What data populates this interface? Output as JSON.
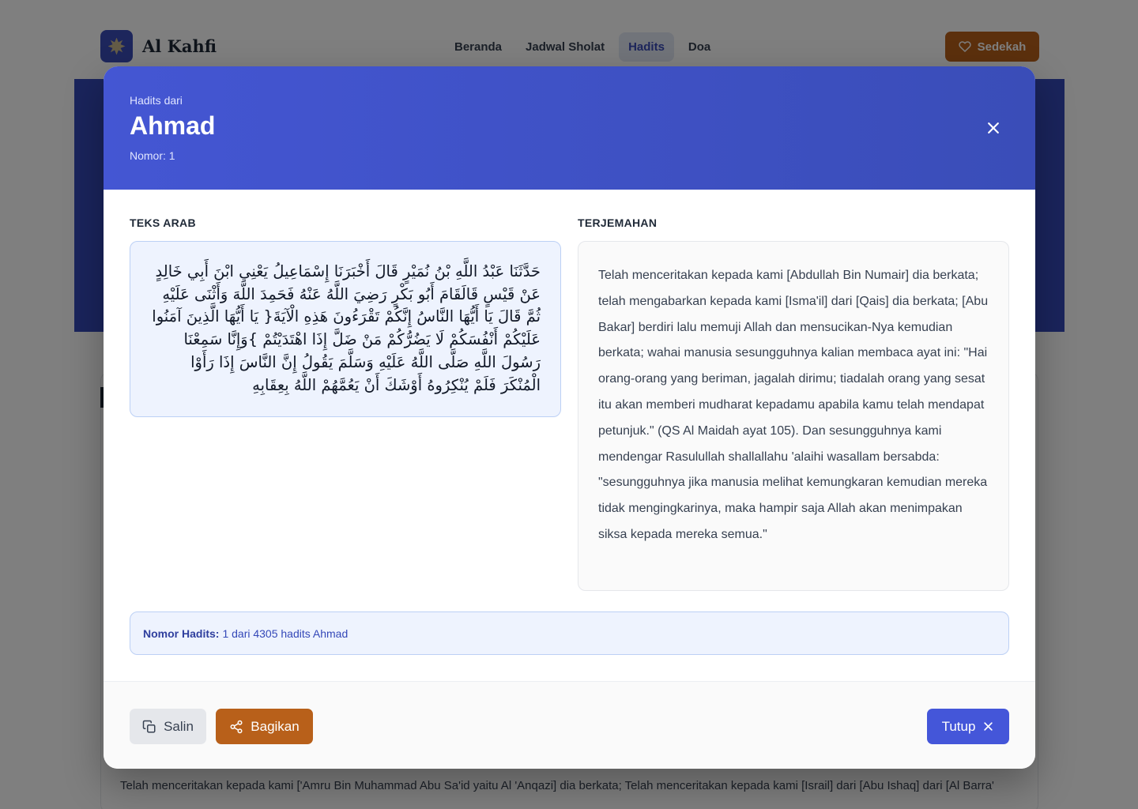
{
  "nav": {
    "brand": "Al Kahfi",
    "links": [
      {
        "label": "Beranda"
      },
      {
        "label": "Jadwal Sholat"
      },
      {
        "label": "Hadits"
      },
      {
        "label": "Doa"
      }
    ],
    "donate_label": "Sedekah"
  },
  "background": {
    "preview_text": "Telah menceritakan kepada kami ['Amru Bin Muhammad Abu Sa'id yaitu Al 'Anqazi] dia berkata; Telah menceritakan kepada kami [Israil] dari [Abu Ishaq] dari [Al Barra'"
  },
  "modal": {
    "kicker": "Hadits dari",
    "title": "Ahmad",
    "nomor": "Nomor: 1",
    "arab_label": "TEKS ARAB",
    "arab_text": "حَدَّثَنَا عَبْدُ اللَّهِ بْنُ نُمَيْرٍ قَالَ أَخْبَرَنَا إِسْمَاعِيلُ يَعْنِي ابْنَ أَبِي خَالِدٍ عَنْ قَيْسٍ قَالَقَامَ أَبُو بَكْرٍ رَضِيَ اللَّهُ عَنْهُ فَحَمِدَ اللَّهَ وَأَثْنَى عَلَيْهِ ثُمَّ قَالَ يَا أَيُّهَا النَّاسُ إِنَّكُمْ تَقْرَءُونَ هَذِهِ الْآيَةَ{ يَا أَيُّهَا الَّذِينَ آمَنُوا عَلَيْكُمْ أَنْفُسَكُمْ لَا يَضُرُّكُمْ مَنْ ضَلَّ إِذَا اهْتَدَيْتُمْ }وَإِنَّا سَمِعْنَا رَسُولَ اللَّهِ صَلَّى اللَّهُ عَلَيْهِ وَسَلَّمَ يَقُولُ إِنَّ النَّاسَ إِذَا رَأَوْا الْمُنْكَرَ فَلَمْ يُنْكِرُوهُ أَوْشَكَ أَنْ يَعُمَّهُمْ اللَّهُ بِعِقَابِهِ",
    "trans_label": "TERJEMAHAN",
    "trans_text": "Telah menceritakan kepada kami [Abdullah Bin Numair] dia berkata; telah mengabarkan kepada kami [Isma'il] dari [Qais] dia berkata; [Abu Bakar] berdiri lalu memuji Allah dan mensucikan-Nya kemudian berkata; wahai manusia sesungguhnya kalian membaca ayat ini: \"Hai orang-orang yang beriman, jagalah dirimu; tiadalah orang yang sesat itu akan memberi mudharat kepadamu apabila kamu telah mendapat petunjuk.\" (QS Al Maidah ayat 105). Dan sesungguhnya kami mendengar Rasulullah shallallahu 'alaihi wasallam bersabda: \"sesungguhnya jika manusia melihat kemungkaran kemudian mereka tidak mengingkarinya, maka hampir saja Allah akan menimpakan siksa kepada mereka semua.\"",
    "info_label": "Nomor Hadits:",
    "info_value": "1 dari 4305 hadits Ahmad",
    "buttons": {
      "copy": "Salin",
      "share": "Bagikan",
      "close": "Tutup"
    }
  },
  "colors": {
    "primary": "#4456d3",
    "accent": "#b8601a"
  }
}
